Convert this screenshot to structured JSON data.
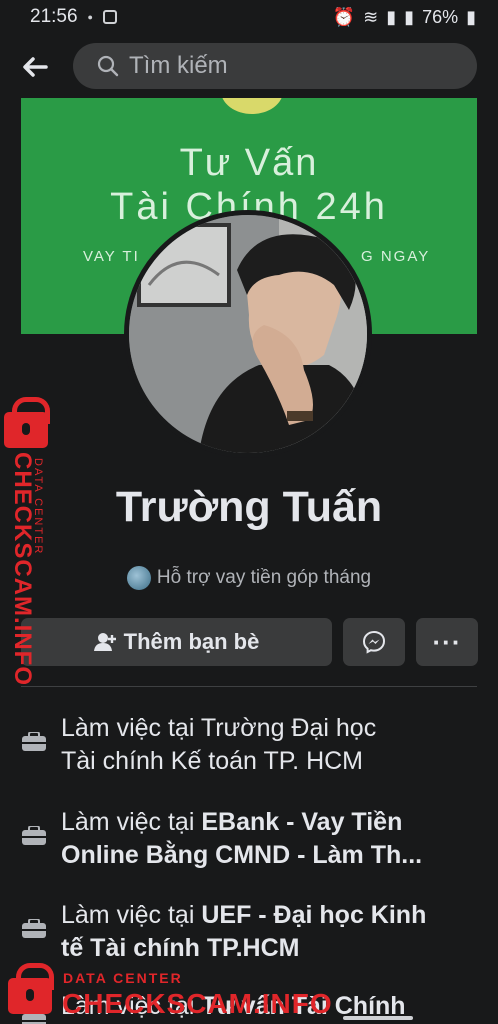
{
  "status_bar": {
    "time": "21:56",
    "battery": "76%",
    "icons": [
      "alarm-icon",
      "wifi-icon",
      "signal-icon",
      "battery-icon"
    ]
  },
  "top_bar": {
    "back_icon": "back-arrow-icon",
    "search_placeholder": "Tìm kiếm"
  },
  "cover": {
    "title_line1": "Tư Vấn",
    "title_line2": "Tài Chính 24h",
    "subtitle_left": "VAY TI",
    "subtitle_right": "G NGAY",
    "bg_color": "#2a9b46"
  },
  "profile": {
    "name": "Trường Tuấn",
    "bio": "Hỗ trợ vay tiền góp tháng"
  },
  "actions": {
    "add_friend_label": "Thêm bạn bè",
    "message_icon": "messenger-icon",
    "more_label": "···"
  },
  "info": [
    {
      "prefix": "Làm việc tại ",
      "line1": "Làm việc tại Trường Đại học",
      "line2": "Tài chính Kế toán TP. HCM"
    },
    {
      "prefix": "Làm việc tại ",
      "bold1": "EBank - Vay Tiền",
      "bold2": "Online Bằng CMND - Làm Th..."
    },
    {
      "prefix": "Làm việc tại ",
      "bold1": "UEF - Đại học Kinh",
      "bold2": "tế Tài chính TP.HCM"
    },
    {
      "prefix": "Làm việc tại ",
      "bold1": "Tư vấn Tài Chính"
    }
  ],
  "watermark": {
    "data_center": "DATA CENTER",
    "site": "CHECKSCAM.INFO",
    "color": "#e0262a"
  }
}
